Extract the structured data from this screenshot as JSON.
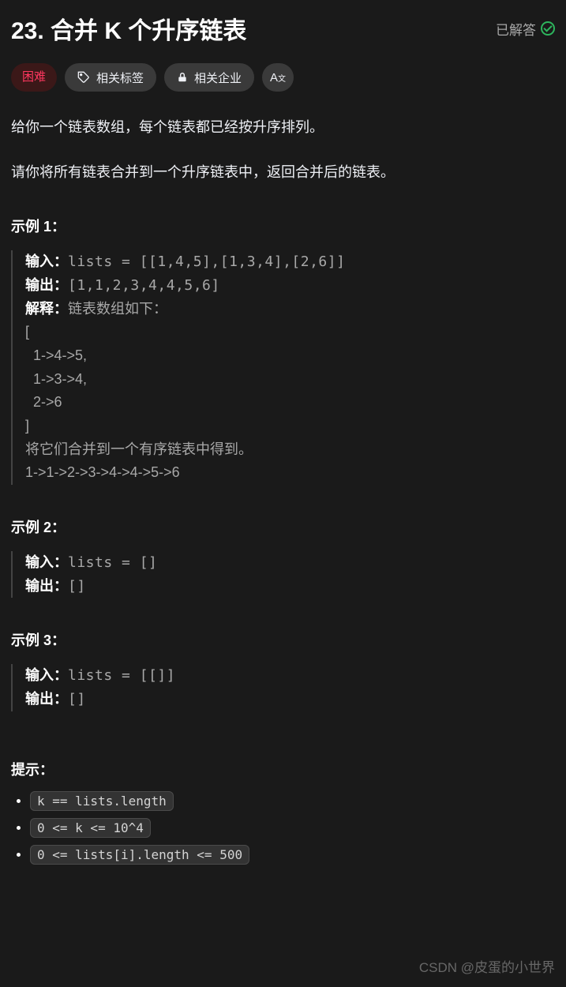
{
  "header": {
    "title": "23. 合并 K 个升序链表",
    "solved_label": "已解答"
  },
  "tags": {
    "difficulty": "困难",
    "related_tags": "相关标签",
    "related_companies": "相关企业",
    "translate_label": "A文"
  },
  "description": {
    "p1": "给你一个链表数组，每个链表都已经按升序排列。",
    "p2": "请你将所有链表合并到一个升序链表中，返回合并后的链表。"
  },
  "examples": [
    {
      "title": "示例 1：",
      "input_label": "输入：",
      "input_value": "lists = [[1,4,5],[1,3,4],[2,6]]",
      "output_label": "输出：",
      "output_value": "[1,1,2,3,4,4,5,6]",
      "explain_label": "解释：",
      "explain_value": "链表数组如下：\n[\n  1->4->5,\n  1->3->4,\n  2->6\n]\n将它们合并到一个有序链表中得到。\n1->1->2->3->4->4->5->6"
    },
    {
      "title": "示例 2：",
      "input_label": "输入：",
      "input_value": "lists = []",
      "output_label": "输出：",
      "output_value": "[]"
    },
    {
      "title": "示例 3：",
      "input_label": "输入：",
      "input_value": "lists = [[]]",
      "output_label": "输出：",
      "output_value": "[]"
    }
  ],
  "constraints": {
    "title": "提示：",
    "items": [
      "k == lists.length",
      "0 <= k <= 10^4",
      "0 <= lists[i].length <= 500"
    ]
  },
  "watermark": "CSDN @皮蛋的小世界"
}
